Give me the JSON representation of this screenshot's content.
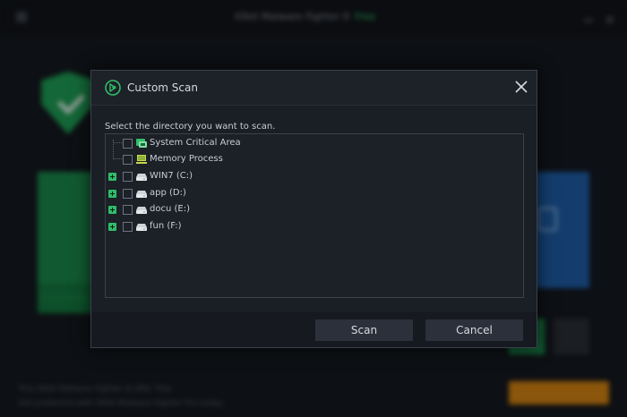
{
  "background": {
    "app_title": "IObit Malware Fighter 8",
    "app_badge": "Free",
    "footer_line1": "This IObit Malware Fighter 8 offer Trial",
    "footer_line2": "Get protected with IObit Malware Fighter Pro today"
  },
  "dialog": {
    "title": "Custom Scan",
    "logo_icon": "iobit-logo-icon",
    "close_icon": "close-icon",
    "instruction": "Select the directory you want to scan.",
    "tree": [
      {
        "label": "System Critical Area",
        "icon": "system-critical-icon",
        "expandable": false,
        "checked": false
      },
      {
        "label": "Memory Process",
        "icon": "memory-icon",
        "expandable": false,
        "checked": false
      },
      {
        "label": "WIN7 (C:)",
        "icon": "drive-icon",
        "expandable": true,
        "checked": false
      },
      {
        "label": "app (D:)",
        "icon": "drive-icon",
        "expandable": true,
        "checked": false
      },
      {
        "label": "docu (E:)",
        "icon": "drive-icon",
        "expandable": true,
        "checked": false
      },
      {
        "label": "fun (F:)",
        "icon": "drive-icon",
        "expandable": true,
        "checked": false
      }
    ],
    "buttons": {
      "scan": "Scan",
      "cancel": "Cancel"
    }
  },
  "colors": {
    "accent_green": "#2fbd6a",
    "dialog_bg": "#1a1e25",
    "button_bg": "#2b303a",
    "warning_orange": "#d68412"
  }
}
